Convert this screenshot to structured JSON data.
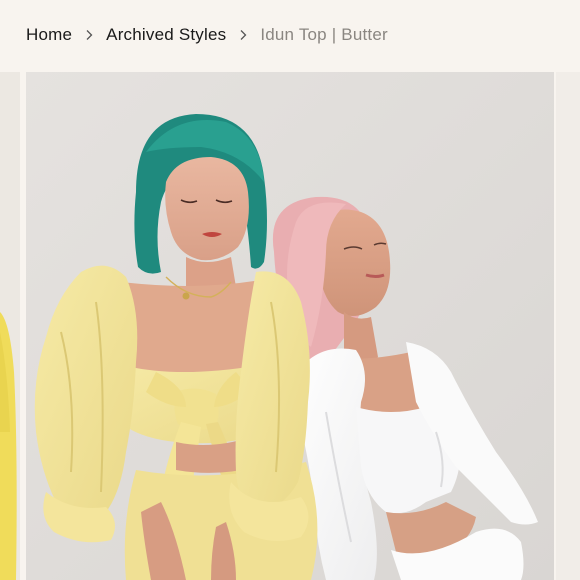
{
  "breadcrumb": {
    "items": [
      {
        "label": "Home",
        "link": true
      },
      {
        "label": "Archived Styles",
        "link": true
      },
      {
        "label": "Idun Top | Butter",
        "link": false
      }
    ],
    "separator_icon": "chevron-right-icon"
  },
  "gallery": {
    "main_image": "product-photo-two-models",
    "colors": {
      "backdrop": "#e2dfdc",
      "butter_yellow": "#f3e59a",
      "white_garment": "#fbfbfb",
      "teal_hair": "#1f8c80",
      "pink_hair": "#e8aeb0"
    }
  }
}
